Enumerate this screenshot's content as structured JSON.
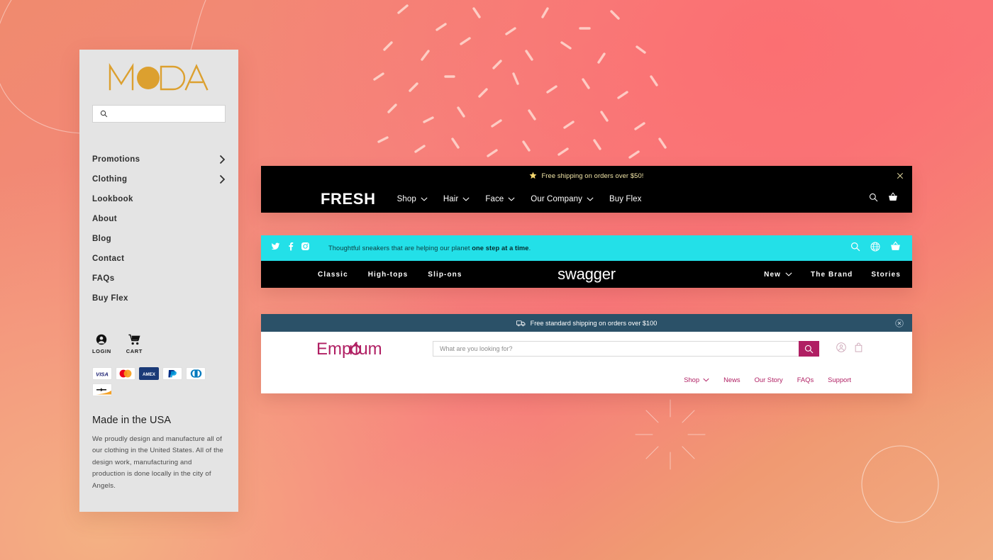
{
  "background": {
    "gradient_from": "#f08a6e",
    "gradient_mid": "#f87a7c",
    "gradient_to": "#f2ad83",
    "decorations": [
      "curved-line",
      "confetti-dashes",
      "sunburst",
      "circle-outline"
    ]
  },
  "moda": {
    "logo_text": "MODA",
    "logo_color": "#dca02f",
    "search": {
      "placeholder": "",
      "value": "",
      "icon": "search-icon"
    },
    "nav_items": [
      {
        "label": "Promotions",
        "has_submenu": true
      },
      {
        "label": "Clothing",
        "has_submenu": true
      },
      {
        "label": "Lookbook",
        "has_submenu": false
      },
      {
        "label": "About",
        "has_submenu": false
      },
      {
        "label": "Blog",
        "has_submenu": false
      },
      {
        "label": "Contact",
        "has_submenu": false
      },
      {
        "label": "FAQs",
        "has_submenu": false
      },
      {
        "label": "Buy Flex",
        "has_submenu": false
      }
    ],
    "account": [
      {
        "label": "LOGIN",
        "icon": "user-account-icon"
      },
      {
        "label": "CART",
        "icon": "shopping-cart-icon"
      }
    ],
    "payment_methods": [
      "VISA",
      "Mastercard",
      "AMEX",
      "PayPal",
      "Diners Club",
      "Discover"
    ],
    "footer_title": "Made in the USA",
    "footer_body": "We proudly design and manufacture all of our clothing in the United States. All of the design work, manufacturing and production is done locally in the city of Angels."
  },
  "fresh": {
    "banner": {
      "text": "Free shipping on orders over $50!",
      "icon": "star-icon",
      "close": "close-icon",
      "text_color": "#f2e6a8",
      "bg": "#000000"
    },
    "logo_text": "FRESH",
    "nav_items": [
      {
        "label": "Shop",
        "has_dropdown": true
      },
      {
        "label": "Hair",
        "has_dropdown": true
      },
      {
        "label": "Face",
        "has_dropdown": true
      },
      {
        "label": "Our Company",
        "has_dropdown": true
      },
      {
        "label": "Buy Flex",
        "has_dropdown": false
      }
    ],
    "icons": [
      "search-icon",
      "shopping-basket-icon"
    ]
  },
  "swagger": {
    "accent": "#23e0e8",
    "social": [
      "twitter-icon",
      "facebook-icon",
      "instagram-icon"
    ],
    "tagline_prefix": "Thoughtful sneakers that are helping our planet ",
    "tagline_bold": "one step at a time",
    "tagline_suffix": ".",
    "top_icons": [
      "search-icon",
      "globe-icon",
      "shopping-basket-icon"
    ],
    "logo_text": "swagger",
    "left_links": [
      {
        "label": "Classic",
        "has_dropdown": false
      },
      {
        "label": "High-tops",
        "has_dropdown": false
      },
      {
        "label": "Slip-ons",
        "has_dropdown": false
      }
    ],
    "right_links": [
      {
        "label": "New",
        "has_dropdown": true
      },
      {
        "label": "The Brand",
        "has_dropdown": false
      },
      {
        "label": "Stories",
        "has_dropdown": false
      }
    ]
  },
  "emporium": {
    "accent": "#b01f63",
    "banner": {
      "text": "Free standard shipping on orders over $100",
      "icon": "delivery-truck-icon",
      "close": "close-icon",
      "bg": "#2b5168"
    },
    "logo_text": "Emporium",
    "search": {
      "placeholder": "What are you looking for?",
      "value": "",
      "button_icon": "search-icon"
    },
    "icons": [
      "user-account-icon",
      "shopping-bag-icon"
    ],
    "nav_items": [
      {
        "label": "Shop",
        "has_dropdown": true
      },
      {
        "label": "News",
        "has_dropdown": false
      },
      {
        "label": "Our Story",
        "has_dropdown": false
      },
      {
        "label": "FAQs",
        "has_dropdown": false
      },
      {
        "label": "Support",
        "has_dropdown": false
      }
    ]
  }
}
